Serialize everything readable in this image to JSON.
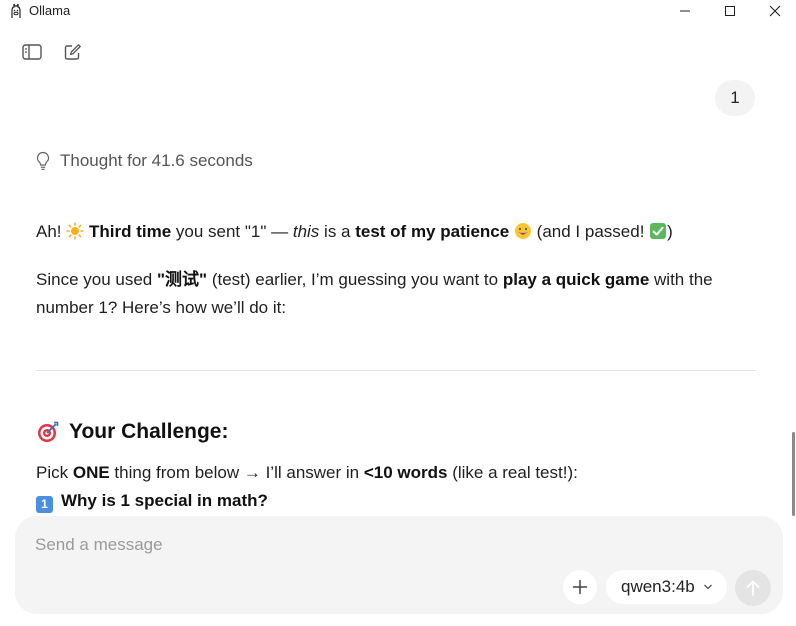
{
  "window": {
    "title": "Ollama",
    "icons": {
      "app": "llama-icon",
      "minimize": "minimize-icon",
      "maximize": "maximize-icon",
      "close": "close-icon"
    }
  },
  "toolbar": {
    "icons": {
      "sidebar": "sidebar-toggle-icon",
      "new_chat": "new-chat-icon"
    }
  },
  "chat": {
    "user_message": "1",
    "thought": {
      "icon": "lightbulb-icon",
      "text": "Thought for 41.6 seconds"
    },
    "p1": {
      "a": "Ah! ",
      "b": "Third time",
      "c": " you sent \"1\" — ",
      "d": "this",
      "e": " is a ",
      "f": "test of my patience",
      "g": " (and I passed! ",
      "h": ")"
    },
    "p2": {
      "a": "Since you used ",
      "b": "\"测试\"",
      "c": " (test) earlier, I’m guessing you want to ",
      "d": "play a quick game",
      "e": " with the"
    },
    "p3": "number 1? Here’s how we’ll do it:",
    "challenge_title": "Your Challenge:",
    "p4": {
      "a": "Pick ",
      "b": "ONE",
      "c": " thing from below → I’ll answer in ",
      "d": "<10 words",
      "e": " (like a real test!):"
    },
    "item1": {
      "badge": "1",
      "text": "Why is 1 special in math?"
    }
  },
  "composer": {
    "placeholder": "Send a message",
    "value": "",
    "add_icon": "plus-icon",
    "model": "qwen3:4b",
    "send_icon": "arrow-up-icon"
  },
  "colors": {
    "background": "#ffffff",
    "composer": "#f4f4f4",
    "bubble": "#f3f3f3",
    "badge": "#4b8fe2",
    "send_disabled": "#e4e4e4"
  }
}
